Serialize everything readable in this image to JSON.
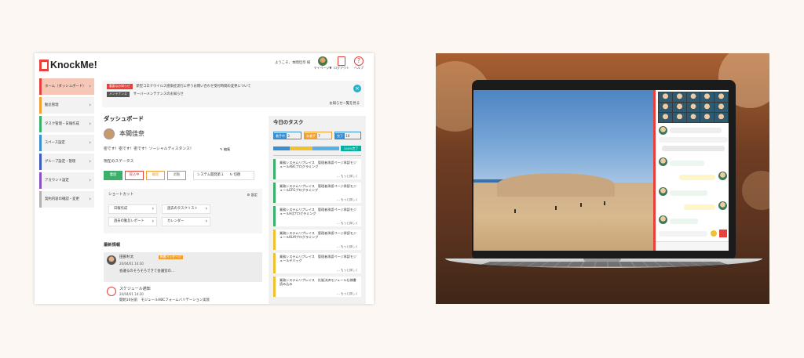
{
  "app": {
    "logo_text": "KnockMe!"
  },
  "header": {
    "welcome": "ようこそ、本間佳奈 様",
    "mypage_label": "マイページ▼",
    "logout_label": "ログアウト",
    "help_label": "ヘルプ"
  },
  "sidebar": {
    "items": [
      {
        "label": "ホーム（ダッシュボード）",
        "color": "#e8403a"
      },
      {
        "label": "勤怠管理",
        "color": "#f0a030"
      },
      {
        "label": "タスク管理・日報作成",
        "color": "#3bb06b"
      },
      {
        "label": "スペース設定",
        "color": "#3a8ed0"
      },
      {
        "label": "グループ設定・管理",
        "color": "#4058c0"
      },
      {
        "label": "アカウント設定",
        "color": "#8a4fc0"
      },
      {
        "label": "契約内容の確認・変更",
        "color": "#b0b0b0"
      }
    ]
  },
  "notice": {
    "items": [
      {
        "tag": "重要なお知らせ",
        "tag_color": "#e8403a",
        "text": "新型コロナウイルス感染症流行に伴うお問い合わせ受付時間の変更について"
      },
      {
        "tag": "メンテナンス",
        "tag_color": "#555555",
        "text": "サーバーメンテナンスのお知らせ"
      }
    ],
    "more": "お知らせ一覧を見る"
  },
  "dashboard": {
    "title": "ダッシュボード",
    "user_name": "本間佳奈",
    "message": "密です！密です！密です！ソーシャルディスタンス！",
    "edit_label": "編集",
    "status_title": "現在のステータス",
    "status_buttons": [
      {
        "label": "着席",
        "color": "#3bb06b",
        "active": true
      },
      {
        "label": "取込中",
        "color": "#e8403a",
        "active": false
      },
      {
        "label": "離席",
        "color": "#f0a030",
        "active": false
      },
      {
        "label": "退勤",
        "color": "#999999",
        "active": false
      }
    ],
    "system_field": "システム開発第１",
    "switch_label": "切替"
  },
  "shortcut": {
    "title": "ショートカット",
    "settings": "設定",
    "items": [
      "日報作成",
      "過去のタスクリスト",
      "過去の勤怠レポート",
      "カレンダー"
    ]
  },
  "news": {
    "title": "最新情報",
    "items": [
      {
        "name": "田部杉太",
        "badge": "新着メッセージ",
        "date": "20/04/01 14:30",
        "text": "会議るのそろそろできて会議室の…"
      },
      {
        "name": "スケジュール通知",
        "badge": "",
        "date": "20/04/01 14:30",
        "text": "開始10分前　モジュールABCフォームバリデーション実装"
      }
    ]
  },
  "tasks": {
    "title": "今日のタスク",
    "counters": [
      {
        "label": "着手中",
        "value": "3",
        "color": "#3a8ed0"
      },
      {
        "label": "未着手",
        "value": "7",
        "color": "#f0a030"
      },
      {
        "label": "完了",
        "value": "10",
        "color": "#3a8ed0"
      }
    ],
    "progress": {
      "label": "100%完了",
      "segments": [
        0.25,
        0.35,
        0.4
      ]
    },
    "more": "… もっと詳しく",
    "items": [
      {
        "text": "業務システムリプレイス　管理者承認ページ承認モジュールABCプログラミング",
        "color": "#3bb06b"
      },
      {
        "text": "業務システムリプレイス　管理者承認ページ承認モジュールEFGプログラミング",
        "color": "#3bb06b"
      },
      {
        "text": "業務システムリプレイス　管理者承認ページ承認モジュールHIJプログラミング",
        "color": "#3bb06b"
      },
      {
        "text": "業務システムリプレイス　管理者承認ページ承認モジュールKLMプログラミング",
        "color": "#f0c030"
      },
      {
        "text": "業務システムリプレイス　管理者承認ページ承認モジュールデバッグ",
        "color": "#f0c030"
      },
      {
        "text": "業務システムリプレイス　社販決済モジュール仕様書読み込み",
        "color": "#f0c030"
      }
    ]
  }
}
